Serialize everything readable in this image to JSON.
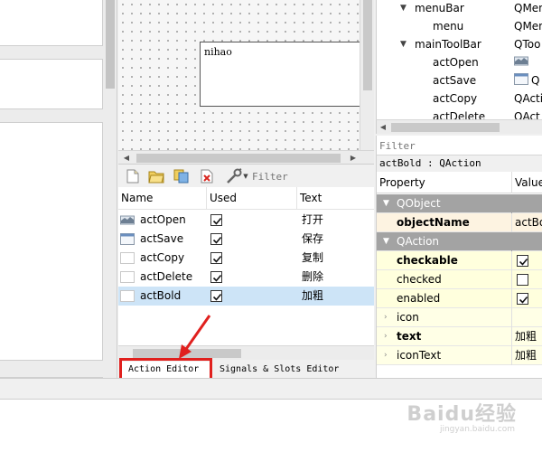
{
  "canvas": {
    "widget_text": "nihao"
  },
  "action_editor": {
    "filter_placeholder": "Filter",
    "columns": [
      "Name",
      "Used",
      "Text"
    ],
    "rows": [
      {
        "name": "actOpen",
        "used": true,
        "text": "打开",
        "icon": "open-action-icon",
        "selected": false
      },
      {
        "name": "actSave",
        "used": true,
        "text": "保存",
        "icon": "save-action-icon",
        "selected": false
      },
      {
        "name": "actCopy",
        "used": true,
        "text": "复制",
        "icon": "blank-icon",
        "selected": false
      },
      {
        "name": "actDelete",
        "used": true,
        "text": "删除",
        "icon": "blank-icon",
        "selected": false
      },
      {
        "name": "actBold",
        "used": true,
        "text": "加粗",
        "icon": "blank-icon",
        "selected": true
      }
    ],
    "toolbar_icons": [
      "new-action-icon",
      "open-folder-icon",
      "copy-icon",
      "delete-icon",
      "configure-icon"
    ]
  },
  "tabs": {
    "action_editor": "Action Editor",
    "signals_slots": "Signals & Slots Editor"
  },
  "object_tree": {
    "rows": [
      {
        "name": "menuBar",
        "class": "QMen",
        "depth": 1,
        "expanded": true
      },
      {
        "name": "menu",
        "class": "QMenu",
        "depth": 2,
        "expanded": null
      },
      {
        "name": "mainToolBar",
        "class": "QToo",
        "depth": 1,
        "expanded": true
      },
      {
        "name": "actOpen",
        "class": "",
        "depth": 2,
        "expanded": null,
        "icon": "open-action-icon"
      },
      {
        "name": "actSave",
        "class": "Q",
        "depth": 2,
        "expanded": null,
        "icon": "save-action-icon"
      },
      {
        "name": "actCopy",
        "class": "QActio",
        "depth": 2,
        "expanded": null
      },
      {
        "name": "actDelete",
        "class": "QAct",
        "depth": 2,
        "expanded": null
      }
    ]
  },
  "property_editor": {
    "filter_placeholder": "Filter",
    "object_label": "actBold : QAction",
    "header": {
      "property": "Property",
      "value": "Value"
    },
    "rows": [
      {
        "kind": "group",
        "name": "QObject"
      },
      {
        "kind": "prop",
        "name": "objectName",
        "value": "actBo",
        "bold": true,
        "style": "y1"
      },
      {
        "kind": "group",
        "name": "QAction"
      },
      {
        "kind": "prop",
        "name": "checkable",
        "checked": true,
        "bold": true,
        "style": "y2"
      },
      {
        "kind": "prop",
        "name": "checked",
        "checked": false,
        "bold": false,
        "style": "y2"
      },
      {
        "kind": "prop",
        "name": "enabled",
        "checked": true,
        "bold": false,
        "style": "y2"
      },
      {
        "kind": "prop",
        "name": "icon",
        "value": "",
        "bold": false,
        "style": "y3",
        "expandable": true
      },
      {
        "kind": "prop",
        "name": "text",
        "value": "加粗",
        "bold": true,
        "style": "y3",
        "expandable": true
      },
      {
        "kind": "prop",
        "name": "iconText",
        "value": "加粗",
        "bold": false,
        "style": "y3",
        "expandable": true
      }
    ]
  },
  "watermark": {
    "text": "Baidu经验",
    "sub": "jingyan.baidu.com"
  },
  "colors": {
    "selection": "#cde4f7",
    "group_header": "#a3a3a3",
    "annotation": "#e0201e"
  }
}
